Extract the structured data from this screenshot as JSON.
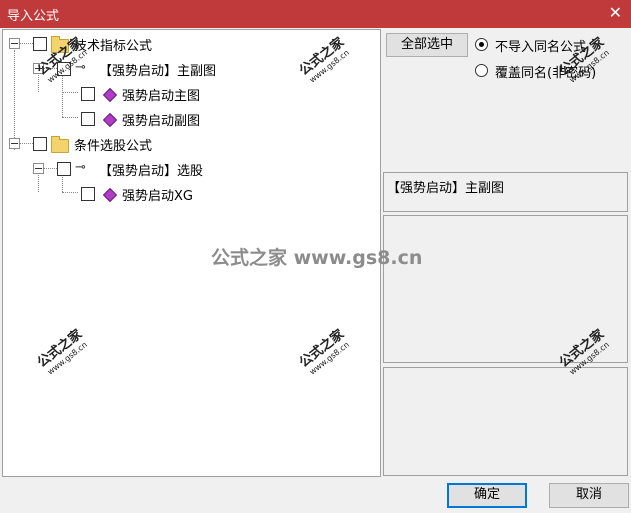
{
  "window": {
    "title": "导入公式",
    "close_glyph": "✕"
  },
  "tree": [
    {
      "label": "技术指标公式",
      "icon": "folder-icon"
    },
    {
      "label": "【强势启动】主副图",
      "icon": "key-icon"
    },
    {
      "label": "强势启动主图",
      "icon": "formula-gem-icon"
    },
    {
      "label": "强势启动副图",
      "icon": "formula-gem-icon"
    },
    {
      "label": "条件选股公式",
      "icon": "folder-icon"
    },
    {
      "label": "【强势启动】选股",
      "icon": "key-icon"
    },
    {
      "label": "强势启动XG",
      "icon": "formula-gem-icon"
    }
  ],
  "buttons": {
    "select_all": "全部选中",
    "ok": "确定",
    "cancel": "取消"
  },
  "options": [
    {
      "label": "不导入同名公式",
      "selected": true
    },
    {
      "label": "覆盖同名(非密码)",
      "selected": false
    }
  ],
  "info": {
    "selected_name": "【强势启动】主副图"
  },
  "watermark": {
    "mark": "公式之家",
    "url": "www.gs8.cn",
    "center": "公式之家 www.gs8.cn"
  },
  "colors": {
    "titlebar": "#c0393b",
    "gem": "#b03cc8",
    "folder": "#f3d36b"
  }
}
